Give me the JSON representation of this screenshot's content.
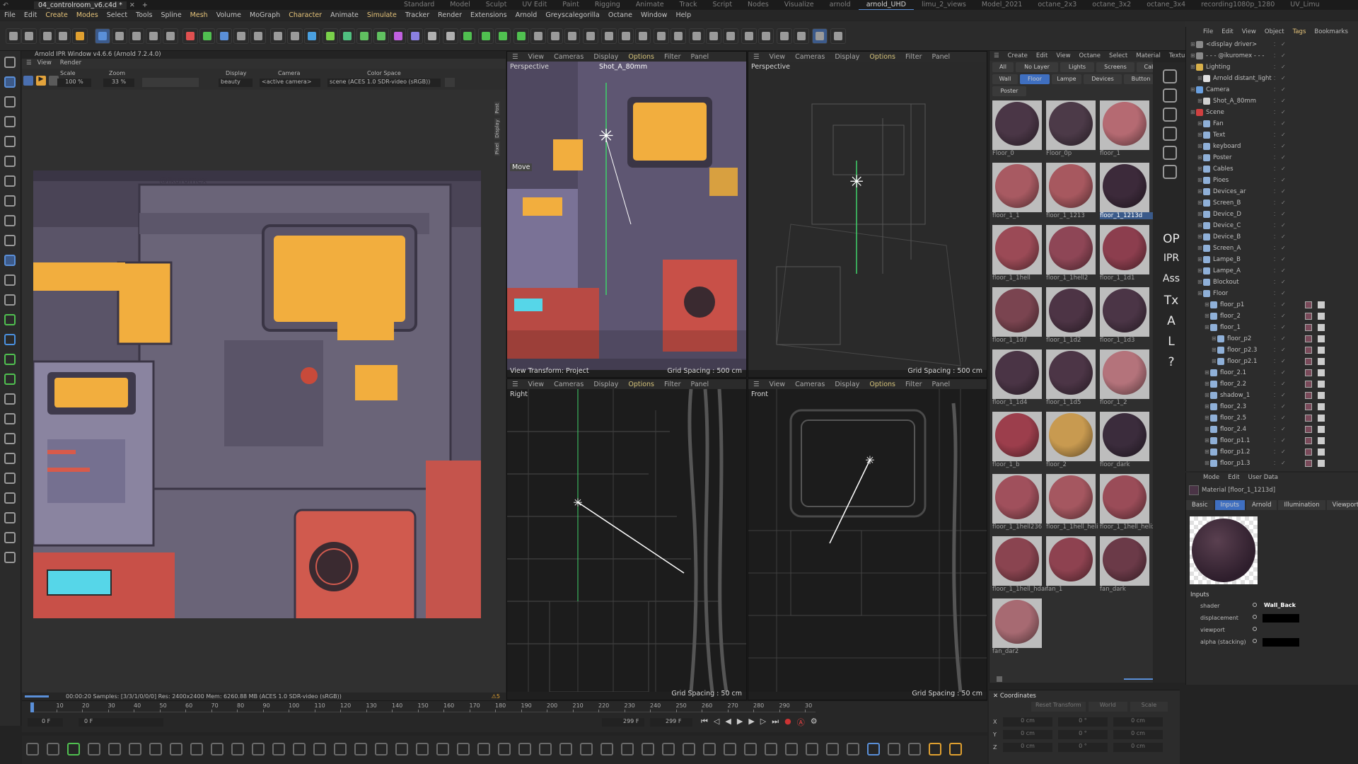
{
  "titlebar": {
    "tabs": [
      "04_controlroom_v6.c4d *"
    ],
    "plus": "+",
    "layouts": [
      "Standard",
      "Model",
      "Sculpt",
      "UV Edit",
      "Paint",
      "Rigging",
      "Animate",
      "Track",
      "Script",
      "Nodes",
      "Visualize",
      "arnold",
      "arnold_UHD",
      "limu_2_views",
      "Model_2021",
      "octane_2x3",
      "octane_3x2",
      "octane_3x4",
      "recording1080p_1280",
      "UV_Limu"
    ],
    "active_layout": "arnold_UHD"
  },
  "menubar": [
    "File",
    "Edit",
    "Create",
    "Modes",
    "Select",
    "Tools",
    "Spline",
    "Mesh",
    "Volume",
    "MoGraph",
    "Character",
    "Animate",
    "Simulate",
    "Tracker",
    "Render",
    "Extensions",
    "Arnold",
    "Greyscalegorilla",
    "Octane",
    "Window",
    "Help"
  ],
  "ipr": {
    "title": "Arnold IPR Window v4.6.6 (Arnold 7.2.4.0)",
    "menu": [
      "View",
      "Render"
    ],
    "scale_label": "Scale",
    "scale_value": "100 %",
    "zoom_label": "Zoom",
    "zoom_value": "33 %",
    "display_label": "Display",
    "display_value": "beauty",
    "camera_label": "Camera",
    "camera_value": "<active camera>",
    "colorspace_label": "Color Space",
    "colorspace_value": "scene (ACES 1.0 SDR-video (sRGB))",
    "status": "00:00:20  Samples: [3/3/1/0/0/0]  Res: 2400x2400  Mem: 6260.88 MB  (ACES 1.0 SDR-video (sRGB))",
    "warning_count": "5",
    "side_tabs": [
      "Post",
      "Display",
      "Pixel"
    ]
  },
  "viewports": [
    {
      "label": "Perspective",
      "camera": "Shot_A_80mm",
      "menu": [
        "View",
        "Cameras",
        "Display",
        "Options",
        "Filter",
        "Panel"
      ],
      "tool": "Move",
      "transform": "View Transform: Project",
      "grid": "Grid Spacing : 500 cm"
    },
    {
      "label": "Perspective",
      "menu": [
        "View",
        "Cameras",
        "Display",
        "Options",
        "Filter",
        "Panel"
      ],
      "grid": "Grid Spacing : 500 cm"
    },
    {
      "label": "Right",
      "menu": [
        "View",
        "Cameras",
        "Display",
        "Options",
        "Filter",
        "Panel"
      ],
      "grid": "Grid Spacing : 50 cm"
    },
    {
      "label": "Front",
      "menu": [
        "View",
        "Cameras",
        "Display",
        "Options",
        "Filter",
        "Panel"
      ],
      "grid": "Grid Spacing : 50 cm"
    }
  ],
  "materials": {
    "menu": [
      "Create",
      "Edit",
      "View",
      "Octane",
      "Select",
      "Material",
      "Texture"
    ],
    "filters_row1": [
      "All",
      "No Layer",
      "Lights",
      "Screens",
      "Cables"
    ],
    "filters_row2": [
      "Wall",
      "Floor",
      "Lampe",
      "Devices",
      "Button"
    ],
    "filters_row3": [
      "Poster"
    ],
    "active_filter": "Floor",
    "items": [
      {
        "name": "Floor_0",
        "color": "#4a3646"
      },
      {
        "name": "Floor_0p",
        "color": "#4c3a48"
      },
      {
        "name": "floor_1",
        "color": "#b56a72"
      },
      {
        "name": "floor_1_1",
        "color": "#a85a62"
      },
      {
        "name": "floor_1_1213",
        "color": "#a7585f"
      },
      {
        "name": "floor_1_1213d",
        "color": "#3c2a3a"
      },
      {
        "name": "floor_1_1hell",
        "color": "#9b4a56"
      },
      {
        "name": "floor_1_1hell2",
        "color": "#8e4656"
      },
      {
        "name": "floor_1_1d1",
        "color": "#8c3e4e"
      },
      {
        "name": "floor_1_1d7",
        "color": "#7a4450"
      },
      {
        "name": "floor_1_1d2",
        "color": "#4d3445"
      },
      {
        "name": "floor_1_1d3",
        "color": "#4b3546"
      },
      {
        "name": "floor_1_1d4",
        "color": "#4a3445"
      },
      {
        "name": "floor_1_1d5",
        "color": "#4c3546"
      },
      {
        "name": "floor_1_2",
        "color": "#b4737b"
      },
      {
        "name": "floor_1_b",
        "color": "#9c3e4c"
      },
      {
        "name": "floor_2",
        "color": "#c89a50"
      },
      {
        "name": "floor_dark",
        "color": "#3b2c3c"
      },
      {
        "name": "floor_1_1hell236",
        "color": "#a0505c"
      },
      {
        "name": "floor_1_1hell_heli",
        "color": "#a55760"
      },
      {
        "name": "floor_1_1hell_helix",
        "color": "#9a4c58"
      },
      {
        "name": "floor_1_1hell_hdar",
        "color": "#8a4450"
      },
      {
        "name": "fan_1",
        "color": "#8e4250"
      },
      {
        "name": "fan_dark",
        "color": "#6b3a48"
      },
      {
        "name": "fan_dar2",
        "color": "#a76a72"
      }
    ],
    "selected": "floor_1_1213d"
  },
  "objects": {
    "menu": [
      "File",
      "Edit",
      "View",
      "Object",
      "Tags",
      "Bookmarks"
    ],
    "rows": [
      {
        "name": "<display driver>",
        "indent": 0,
        "color": "#8a8a8a"
      },
      {
        "name": "- - - @ikuromex - - -",
        "indent": 0,
        "color": "#8a8a8a"
      },
      {
        "name": "Lighting",
        "indent": 0,
        "color": "#d8b04a"
      },
      {
        "name": "Arnold distant_light",
        "indent": 1,
        "color": "#e0e0e0"
      },
      {
        "name": "Camera",
        "indent": 0,
        "color": "#6aa0e0"
      },
      {
        "name": "Shot_A_80mm",
        "indent": 1,
        "color": "#d0d0d0"
      },
      {
        "name": "Scene",
        "indent": 0,
        "color": "#d04040"
      },
      {
        "name": "Fan",
        "indent": 1,
        "color": "#8fb0d8"
      },
      {
        "name": "Text",
        "indent": 1,
        "color": "#8fb0d8"
      },
      {
        "name": "keyboard",
        "indent": 1,
        "color": "#8fb0d8"
      },
      {
        "name": "Poster",
        "indent": 1,
        "color": "#8fb0d8"
      },
      {
        "name": "Cables",
        "indent": 1,
        "color": "#8fb0d8"
      },
      {
        "name": "Pioes",
        "indent": 1,
        "color": "#8fb0d8"
      },
      {
        "name": "Devices_ar",
        "indent": 1,
        "color": "#8fb0d8"
      },
      {
        "name": "Screen_B",
        "indent": 1,
        "color": "#8fb0d8"
      },
      {
        "name": "Device_D",
        "indent": 1,
        "color": "#8fb0d8"
      },
      {
        "name": "Device_C",
        "indent": 1,
        "color": "#8fb0d8"
      },
      {
        "name": "Device_B",
        "indent": 1,
        "color": "#8fb0d8"
      },
      {
        "name": "Screen_A",
        "indent": 1,
        "color": "#8fb0d8"
      },
      {
        "name": "Lampe_B",
        "indent": 1,
        "color": "#8fb0d8"
      },
      {
        "name": "Lampe_A",
        "indent": 1,
        "color": "#8fb0d8"
      },
      {
        "name": "Blockout",
        "indent": 1,
        "color": "#8fb0d8"
      },
      {
        "name": "Floor",
        "indent": 1,
        "color": "#8fb0d8"
      },
      {
        "name": "floor_p1",
        "indent": 2,
        "color": "#8fb0d8"
      },
      {
        "name": "floor_2",
        "indent": 2,
        "color": "#8fb0d8"
      },
      {
        "name": "floor_1",
        "indent": 2,
        "color": "#8fb0d8"
      },
      {
        "name": "floor_p2",
        "indent": 3,
        "color": "#8fb0d8"
      },
      {
        "name": "floor_p2.3",
        "indent": 3,
        "color": "#8fb0d8"
      },
      {
        "name": "floor_p2.1",
        "indent": 3,
        "color": "#8fb0d8"
      },
      {
        "name": "floor_2.1",
        "indent": 2,
        "color": "#8fb0d8"
      },
      {
        "name": "floor_2.2",
        "indent": 2,
        "color": "#8fb0d8"
      },
      {
        "name": "shadow_1",
        "indent": 2,
        "color": "#8fb0d8"
      },
      {
        "name": "floor_2.3",
        "indent": 2,
        "color": "#8fb0d8"
      },
      {
        "name": "floor_2.5",
        "indent": 2,
        "color": "#8fb0d8"
      },
      {
        "name": "floor_2.4",
        "indent": 2,
        "color": "#8fb0d8"
      },
      {
        "name": "floor_p1.1",
        "indent": 2,
        "color": "#8fb0d8"
      },
      {
        "name": "floor_p1.2",
        "indent": 2,
        "color": "#8fb0d8"
      },
      {
        "name": "floor_p1.3",
        "indent": 2,
        "color": "#8fb0d8"
      }
    ]
  },
  "attributes": {
    "menu": [
      "Mode",
      "Edit",
      "User Data"
    ],
    "title": "Material [floor_1_1213d]",
    "tabs": [
      "Basic",
      "Inputs",
      "Arnold",
      "Illumination",
      "Viewport"
    ],
    "active_tab": "Inputs",
    "section": "Inputs",
    "fields": [
      {
        "label": "shader",
        "value": "Wall_Back"
      },
      {
        "label": "displacement",
        "value": ""
      },
      {
        "label": "viewport",
        "value": ""
      },
      {
        "label": "alpha (stacking)",
        "value": ""
      }
    ]
  },
  "coordinates": {
    "title": "Coordinates",
    "reset": "Reset Transform",
    "space": "World",
    "mode": "Scale",
    "rows": [
      {
        "axis": "X",
        "pos": "0 cm",
        "rot": "0 °",
        "scale": "0 cm"
      },
      {
        "axis": "Y",
        "pos": "0 cm",
        "rot": "0 °",
        "scale": "0 cm"
      },
      {
        "axis": "Z",
        "pos": "0 cm",
        "rot": "0 °",
        "scale": "0 cm"
      }
    ]
  },
  "timeline": {
    "ticks": [
      "0",
      "10",
      "20",
      "30",
      "40",
      "50",
      "60",
      "70",
      "80",
      "90",
      "100",
      "110",
      "120",
      "130",
      "140",
      "150",
      "160",
      "170",
      "180",
      "190",
      "200",
      "210",
      "220",
      "230",
      "240",
      "250",
      "260",
      "270",
      "280",
      "290",
      "30"
    ],
    "current_frame": "0 F",
    "start_frame": "0 F",
    "end_frame_a": "299 F",
    "end_frame_b": "299 F"
  },
  "sidestrip": [
    "OP",
    "IPR",
    "Ass",
    "Tx",
    "A",
    "L",
    "?"
  ],
  "colors": {
    "accent": "#5a8fd8",
    "ipr_screen": "#f2a93b",
    "mat_selected": "#3a5a8a"
  }
}
